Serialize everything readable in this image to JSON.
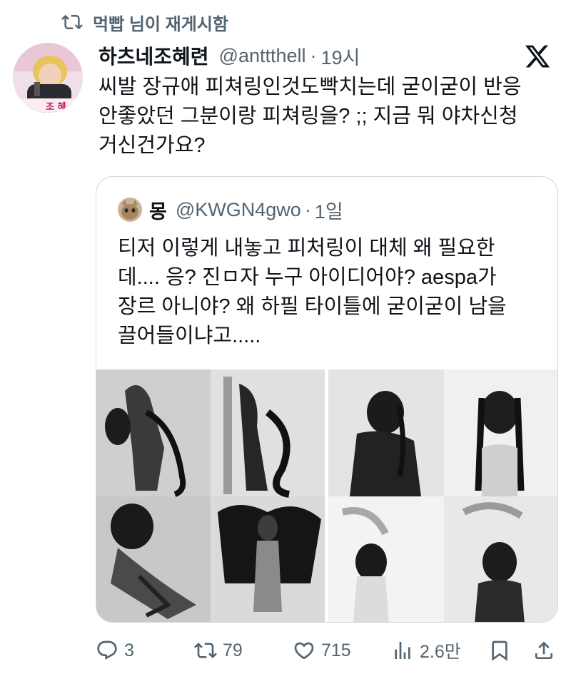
{
  "repost": {
    "text": "먹빱 님이 재게시함",
    "icon": "repost-icon"
  },
  "author": {
    "name": "하츠네조혜련",
    "handle": "@anttthell",
    "dot": "·",
    "time": "19시"
  },
  "tweet": {
    "lines": [
      "씨발 장규애 피쳐링인것도빡치는데 굳이굳이 반응",
      "안좋았던 그분이랑 피쳐링을? ;; 지금 뭐 야차신청",
      "거신건가요?"
    ]
  },
  "avatar_badge": "조 혜",
  "quote": {
    "name": "몽",
    "handle": "@KWGN4gwo",
    "dot": "·",
    "time": "1일",
    "lines": [
      "티저 이렇게 내놓고 피처링이 대체 왜 필요한",
      "데.... 응? 진ㅁ자 누구 아이디어야? aespa가",
      "장르 아니야? 왜 하필 타이틀에 굳이굳이 남을",
      "끌어들이냐고....."
    ]
  },
  "actions": {
    "replies": "3",
    "reposts": "79",
    "likes": "715",
    "views": "2.6만"
  },
  "icons": [
    "repost-icon",
    "x-logo-icon",
    "reply-icon",
    "retweet-icon",
    "like-icon",
    "views-icon",
    "bookmark-icon",
    "share-icon"
  ],
  "colors": {
    "text": "#0f1419",
    "muted": "#536471",
    "border": "#cfd9de"
  }
}
